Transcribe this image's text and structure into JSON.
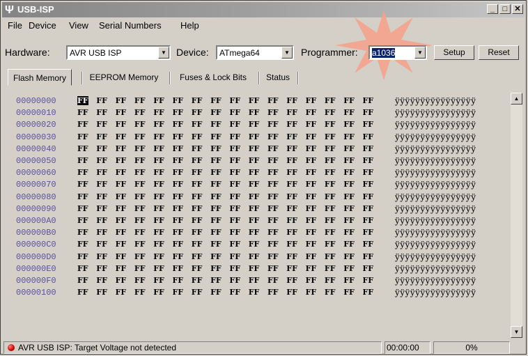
{
  "window": {
    "title": "USB-ISP"
  },
  "menu": [
    "File",
    "Device",
    "View",
    "Serial Numbers",
    "Help"
  ],
  "hardware": {
    "hardware_label": "Hardware:",
    "hardware_value": "AVR USB ISP",
    "device_label": "Device:",
    "device_value": "ATmega64",
    "programmer_label": "Programmer:",
    "programmer_value": "a1036",
    "setup_label": "Setup",
    "reset_label": "Reset"
  },
  "tabs": [
    "Flash Memory",
    "EEPROM Memory",
    "Fuses & Lock Bits",
    "Status"
  ],
  "hex": {
    "addresses": [
      "00000000",
      "00000010",
      "00000020",
      "00000030",
      "00000040",
      "00000050",
      "00000060",
      "00000070",
      "00000080",
      "00000090",
      "000000A0",
      "000000B0",
      "000000C0",
      "000000D0",
      "000000E0",
      "000000F0",
      "00000100"
    ],
    "byte": "FF",
    "ascii": "ÿÿÿÿÿÿÿÿÿÿÿÿÿÿÿÿ"
  },
  "status": {
    "message": "AVR USB ISP: Target Voltage not detected",
    "time": "00:00:00",
    "progress": "0%"
  },
  "colors": {
    "address": "#5a4f9e",
    "led": "#cc0000",
    "starburst": "#f4a28c"
  }
}
